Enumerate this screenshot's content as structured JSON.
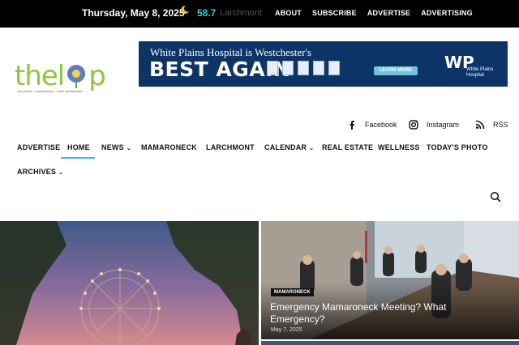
{
  "topbar": {
    "date": "Thursday, May 8, 2025",
    "weather_icon": "moon-icon",
    "temperature": "58.7",
    "location": "Larchmont",
    "links": [
      "ABOUT",
      "SUBSCRIBE",
      "ADVERTISE",
      "ADVERTISING"
    ]
  },
  "logo": {
    "wordmark_left": "thel",
    "wordmark_right": "p",
    "tagline": "larchmont · mamaroneck · lower westchester"
  },
  "banner": {
    "line1": "White Plains Hospital is Westchester's",
    "line2": "BEST AGAIN",
    "cta": "LEARN MORE",
    "brand_mark": "WP",
    "brand_name": "White Plains Hospital"
  },
  "social": [
    {
      "icon": "facebook-icon",
      "label": "Facebook"
    },
    {
      "icon": "instagram-icon",
      "label": "Instagram"
    },
    {
      "icon": "rss-icon",
      "label": "RSS"
    }
  ],
  "nav": {
    "items": [
      {
        "label": "ADVERTISE",
        "dropdown": false
      },
      {
        "label": "HOME",
        "dropdown": false,
        "active": true
      },
      {
        "label": "NEWS",
        "dropdown": true
      },
      {
        "label": "MAMARONECK",
        "dropdown": false
      },
      {
        "label": "LARCHMONT",
        "dropdown": false
      },
      {
        "label": "CALENDAR",
        "dropdown": true
      },
      {
        "label": "REAL ESTATE",
        "dropdown": false
      },
      {
        "label": "WELLNESS",
        "dropdown": false
      },
      {
        "label": "TODAY'S PHOTO",
        "dropdown": false
      },
      {
        "label": "ARCHIVES",
        "dropdown": true
      }
    ],
    "active_color": "#4db2ec"
  },
  "featured": {
    "right": {
      "category": "MAMARONECK",
      "title": "Emergency Mamaroneck Meeting? What Emergency?",
      "date": "May 7, 2025"
    }
  }
}
